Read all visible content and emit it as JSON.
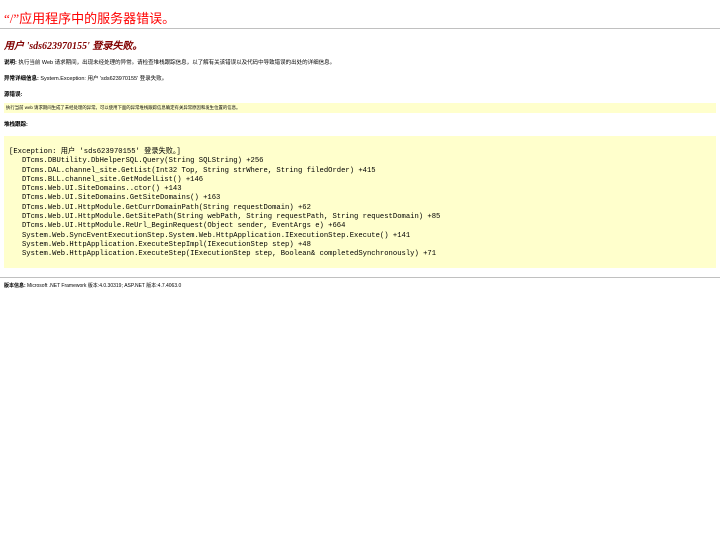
{
  "page": {
    "title": "“/”应用程序中的服务器错误。",
    "error_title": "用户 'sds623970155' 登录失败。"
  },
  "description": {
    "label": "说明:",
    "text": " 执行当前 Web 请求期间，出现未经处理的异常。请检查堆栈跟踪信息，以了解有关该错误以及代码中导致错误的出处的详细信息。"
  },
  "exception_details": {
    "label": "异常详细信息:",
    "text": " System.Exception: 用户 'sds623970155' 登录失败。"
  },
  "source_error": {
    "label": "源错误:",
    "text": "执行当前 web 请求期间生成了未经处理的异常。可以使用下面的异常堆栈跟踪信息确定有关异常原因和发生位置的信息。"
  },
  "stack_trace": {
    "label": "堆栈跟踪:",
    "lines": [
      "",
      "[Exception: 用户 'sds623970155' 登录失败。]",
      "   DTcms.DBUtility.DbHelperSQL.Query(String SQLString) +256",
      "   DTcms.DAL.channel_site.GetList(Int32 Top, String strWhere, String filedOrder) +415",
      "   DTcms.BLL.channel_site.GetModelList() +146",
      "   DTcms.Web.UI.SiteDomains..ctor() +143",
      "   DTcms.Web.UI.SiteDomains.GetSiteDomains() +163",
      "   DTcms.Web.UI.HttpModule.GetCurrDomainPath(String requestDomain) +62",
      "   DTcms.Web.UI.HttpModule.GetSitePath(String webPath, String requestPath, String requestDomain) +85",
      "   DTcms.Web.UI.HttpModule.ReUrl_BeginRequest(Object sender, EventArgs e) +664",
      "   System.Web.SyncEventExecutionStep.System.Web.HttpApplication.IExecutionStep.Execute() +141",
      "   System.Web.HttpApplication.ExecuteStepImpl(IExecutionStep step) +48",
      "   System.Web.HttpApplication.ExecuteStep(IExecutionStep step, Boolean& completedSynchronously) +71"
    ]
  },
  "version": {
    "label": "版本信息:",
    "text": " Microsoft .NET Framework 版本:4.0.30319; ASP.NET 版本:4.7.4063.0"
  },
  "colors": {
    "title": "#ff0000",
    "error_title": "#800000",
    "box_background": "#ffffcc",
    "rule": "#c0c0c0"
  }
}
